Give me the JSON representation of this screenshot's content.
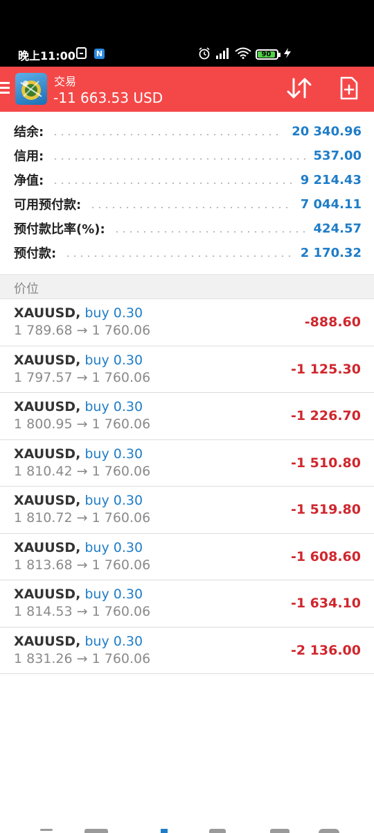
{
  "status_bar": {
    "time": "晚上11:00",
    "battery": "90",
    "icons": [
      "note-icon",
      "n-app-icon",
      "alarm-icon",
      "signal-icon",
      "wifi-icon",
      "battery-icon",
      "charging-icon"
    ]
  },
  "header": {
    "title": "交易",
    "balance": "-11 663.53 USD",
    "color": "#f44848"
  },
  "summary": [
    {
      "label": "结余:",
      "value": "20 340.96"
    },
    {
      "label": "信用:",
      "value": "537.00"
    },
    {
      "label": "净值:",
      "value": "9 214.43"
    },
    {
      "label": "可用预付款:",
      "value": "7 044.11"
    },
    {
      "label": "预付款比率(%):",
      "value": "424.57"
    },
    {
      "label": "预付款:",
      "value": "2 170.32"
    }
  ],
  "section_title": "价位",
  "positions": [
    {
      "symbol": "XAUUSD,",
      "type": "buy 0.30",
      "prices": "1 789.68 → 1 760.06",
      "profit": "-888.60"
    },
    {
      "symbol": "XAUUSD,",
      "type": "buy 0.30",
      "prices": "1 797.57 → 1 760.06",
      "profit": "-1 125.30"
    },
    {
      "symbol": "XAUUSD,",
      "type": "buy 0.30",
      "prices": "1 800.95 → 1 760.06",
      "profit": "-1 226.70"
    },
    {
      "symbol": "XAUUSD,",
      "type": "buy 0.30",
      "prices": "1 810.42 → 1 760.06",
      "profit": "-1 510.80"
    },
    {
      "symbol": "XAUUSD,",
      "type": "buy 0.30",
      "prices": "1 810.72 → 1 760.06",
      "profit": "-1 519.80"
    },
    {
      "symbol": "XAUUSD,",
      "type": "buy 0.30",
      "prices": "1 813.68 → 1 760.06",
      "profit": "-1 608.60"
    },
    {
      "symbol": "XAUUSD,",
      "type": "buy 0.30",
      "prices": "1 814.53 → 1 760.06",
      "profit": "-1 634.10"
    },
    {
      "symbol": "XAUUSD,",
      "type": "buy 0.30",
      "prices": "1 831.26 → 1 760.06",
      "profit": "-2 136.00"
    }
  ],
  "colors": {
    "value_blue": "#1f7dc8",
    "loss_red": "#d0262d"
  }
}
